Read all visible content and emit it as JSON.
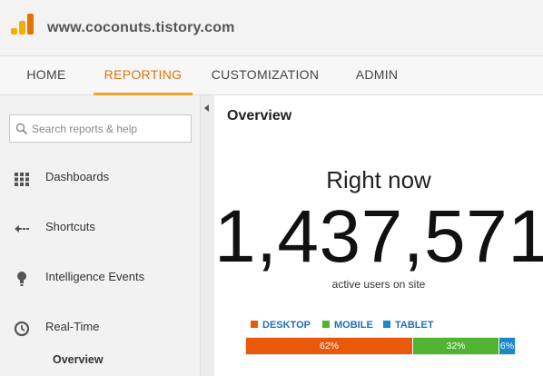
{
  "header": {
    "site_title": "www.coconuts.tistory.com",
    "logo_icon": "analytics-bars-icon"
  },
  "nav": {
    "tabs": [
      {
        "label": "HOME",
        "active": false
      },
      {
        "label": "REPORTING",
        "active": true
      },
      {
        "label": "CUSTOMIZATION",
        "active": false
      },
      {
        "label": "ADMIN",
        "active": false
      }
    ]
  },
  "sidebar": {
    "search_placeholder": "Search reports & help",
    "items": [
      {
        "label": "Dashboards",
        "icon": "grid-icon"
      },
      {
        "label": "Shortcuts",
        "icon": "shortcut-arrow-icon"
      },
      {
        "label": "Intelligence Events",
        "icon": "lightbulb-icon"
      },
      {
        "label": "Real-Time",
        "icon": "clock-icon"
      }
    ],
    "subitem": "Overview"
  },
  "main": {
    "title": "Overview",
    "right_now_label": "Right now",
    "active_users_count": "1,437,571",
    "active_users_label": "active users on site",
    "devices": [
      {
        "label": "DESKTOP",
        "percent": 62,
        "percent_label": "62%",
        "color": "#e8590c"
      },
      {
        "label": "MOBILE",
        "percent": 32,
        "percent_label": "32%",
        "color": "#50b432"
      },
      {
        "label": "TABLET",
        "percent": 6,
        "percent_label": "6%",
        "color": "#1a87c9"
      }
    ]
  },
  "colors": {
    "accent": "#e8710a",
    "tab_underline": "#f2a130"
  }
}
